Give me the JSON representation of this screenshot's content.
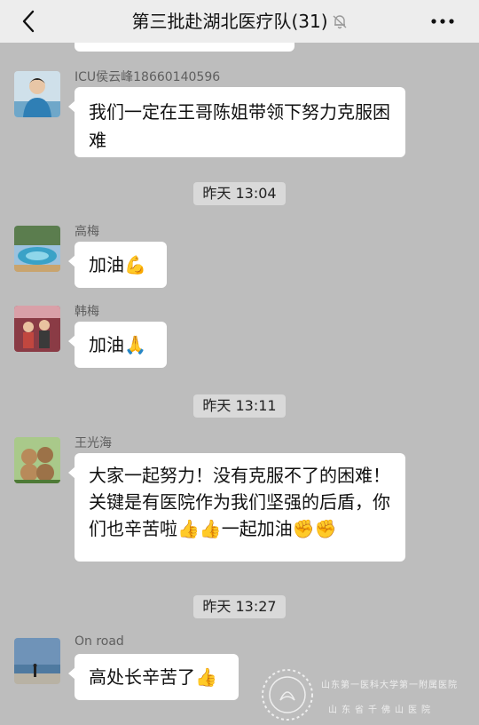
{
  "header": {
    "title": "第三批赴湖北医疗队(31)",
    "muted_icon": "bell-off-icon",
    "back_icon": "chevron-left-icon",
    "more_icon": "more-icon"
  },
  "messages": [
    {
      "sender": "ICU侯云峰18660140596",
      "text": "我们一定在王哥陈姐带领下努力克服困难",
      "avatar": "person-avatar"
    },
    {
      "sender": "高梅",
      "text": "加油💪",
      "avatar": "hot-spring-avatar"
    },
    {
      "sender": "韩梅",
      "text": "加油🙏",
      "avatar": "group-photo-avatar"
    },
    {
      "sender": "王光海",
      "text": "大家一起努力！没有克服不了的困难！关键是有医院作为我们坚强的后盾，你们也辛苦啦👍👍一起加油✊✊",
      "avatar": "monkeys-avatar"
    },
    {
      "sender": "On  road",
      "text": "高处长辛苦了👍",
      "avatar": "beach-avatar"
    }
  ],
  "timestamps": [
    "昨天 13:04",
    "昨天 13:11",
    "昨天 13:27"
  ],
  "watermark": {
    "line1": "山东第一医科大学第一附属医院",
    "line2": "山东省千佛山医院"
  },
  "colors": {
    "background": "#bdbdbd",
    "bubble": "#ffffff",
    "header": "#ededed"
  }
}
